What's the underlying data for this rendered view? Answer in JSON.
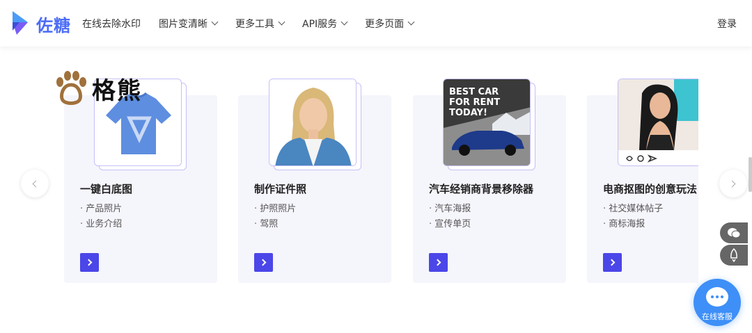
{
  "header": {
    "logo_text": "佐糖",
    "nav": [
      {
        "label": "在线去除水印",
        "has_menu": false
      },
      {
        "label": "图片变清晰",
        "has_menu": true
      },
      {
        "label": "更多工具",
        "has_menu": true
      },
      {
        "label": "API服务",
        "has_menu": true
      },
      {
        "label": "更多页面",
        "has_menu": true
      }
    ],
    "login": "登录"
  },
  "watermark": {
    "text": "格熊"
  },
  "cards": [
    {
      "title": "一键白底图",
      "items": [
        "产品照片",
        "业务介绍"
      ],
      "image": "blue-tshirt"
    },
    {
      "title": "制作证件照",
      "items": [
        "护照照片",
        "驾照"
      ],
      "image": "portrait-woman"
    },
    {
      "title": "汽车经销商背景移除器",
      "items": [
        "汽车海报",
        "宣传单页"
      ],
      "image": "car-poster"
    },
    {
      "title": "电商抠图的创意玩法",
      "items": [
        "社交媒体帖子",
        "商标海报"
      ],
      "image": "social-post-woman"
    }
  ],
  "car_poster_text": "BEST CAR\nFOR RENT\nTODAY!",
  "chat": {
    "label": "在线客服"
  },
  "colors": {
    "brand": "#4b6cf7",
    "button": "#4b46e8",
    "card_bg": "#f5f5fc",
    "chat": "#3e8ff7"
  }
}
